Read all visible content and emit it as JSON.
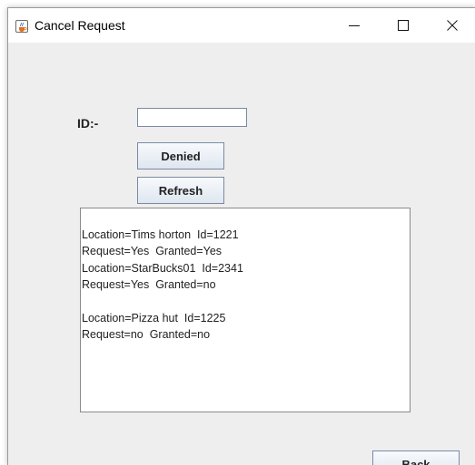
{
  "window": {
    "title": "Cancel Request",
    "controls": {
      "minimize": "—",
      "maximize": "☐",
      "close": "✕"
    }
  },
  "form": {
    "id_label": "ID:-",
    "id_value": "",
    "denied_label": "Denied",
    "refresh_label": "Refresh",
    "back_label": "Back"
  },
  "results": {
    "lines": [
      "Location=Tims horton  Id=1221",
      "Request=Yes  Granted=Yes",
      "Location=StarBucks01  Id=2341",
      "Request=Yes  Granted=no",
      "",
      "Location=Pizza hut  Id=1225",
      "Request=no  Granted=no"
    ]
  },
  "colors": {
    "window_bg": "#eeeeee",
    "button_border": "#7a8aa5"
  },
  "icons": {
    "app": "java-cup-icon"
  }
}
